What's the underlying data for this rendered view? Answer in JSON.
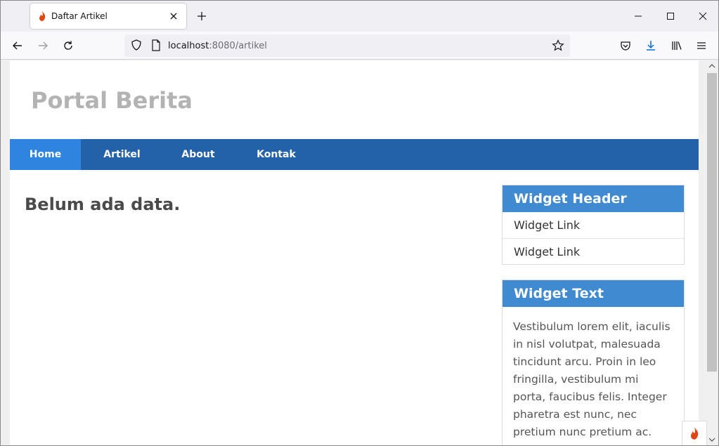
{
  "browser": {
    "tab_title": "Daftar Artikel",
    "url_host": "localhost",
    "url_port": ":8080/artikel"
  },
  "site": {
    "title": "Portal Berita",
    "nav": [
      {
        "label": "Home",
        "active": true
      },
      {
        "label": "Artikel",
        "active": false
      },
      {
        "label": "About",
        "active": false
      },
      {
        "label": "Kontak",
        "active": false
      }
    ],
    "empty_message": "Belum ada data."
  },
  "sidebar": {
    "links_widget": {
      "header": "Widget Header",
      "links": [
        "Widget Link",
        "Widget Link"
      ]
    },
    "text_widget": {
      "header": "Widget Text",
      "body": "Vestibulum lorem elit, iaculis in nisl volutpat, malesuada tincidunt arcu. Proin in leo fringilla, vestibulum mi porta, faucibus felis. Integer pharetra est nunc, nec pretium nunc pretium ac."
    }
  },
  "colors": {
    "nav_bg": "#2362a9",
    "nav_active": "#2f84e0",
    "widget_header": "#3f8ad0",
    "site_title": "#b3b3b3"
  }
}
